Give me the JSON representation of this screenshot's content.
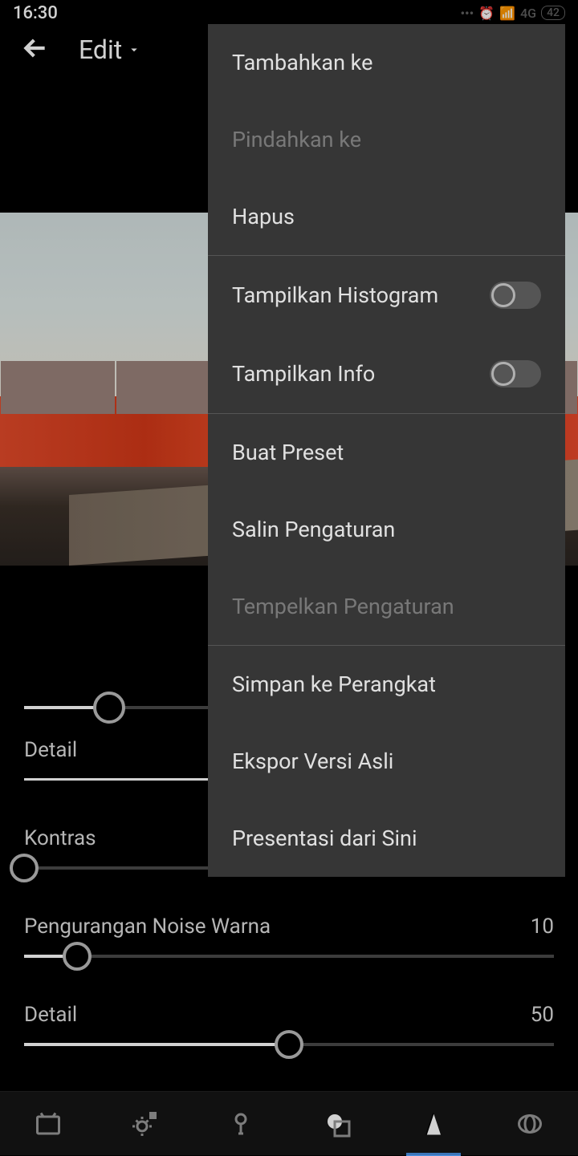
{
  "status": {
    "time": "16:30",
    "network": "4G",
    "battery": "42"
  },
  "toolbar": {
    "edit_label": "Edit"
  },
  "menu": {
    "add_to": "Tambahkan ke",
    "move_to": "Pindahkan ke",
    "delete": "Hapus",
    "show_histogram": "Tampilkan Histogram",
    "show_info": "Tampilkan Info",
    "create_preset": "Buat Preset",
    "copy_settings": "Salin Pengaturan",
    "paste_settings": "Tempelkan Pengaturan",
    "save_to_device": "Simpan ke Perangkat",
    "export_original": "Ekspor Versi Asli",
    "present_from_here": "Presentasi dari Sini"
  },
  "sliders": {
    "s0": {
      "pos": 16
    },
    "detail_tab": {
      "label": "Detail"
    },
    "kontras": {
      "label": "Kontras",
      "value": "",
      "pos": 0
    },
    "noise_color": {
      "label": "Pengurangan Noise Warna",
      "value": "10",
      "pos": 10
    },
    "detail2": {
      "label": "Detail",
      "value": "50",
      "pos": 50
    }
  }
}
